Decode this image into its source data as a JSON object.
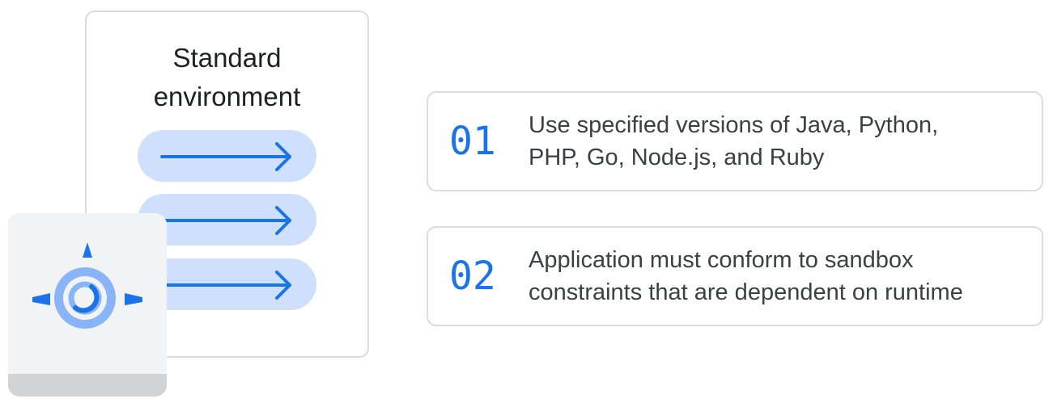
{
  "environment": {
    "title_line1": "Standard",
    "title_line2": "environment",
    "flows": [
      {
        "icon": "arrow-right-icon"
      },
      {
        "icon": "arrow-right-icon"
      },
      {
        "icon": "arrow-right-icon"
      }
    ]
  },
  "app_engine": {
    "icon": "app-engine-icon"
  },
  "items": [
    {
      "number": "01",
      "line1": "Use specified versions of Java, Python,",
      "line2": "PHP, Go, Node.js, and Ruby"
    },
    {
      "number": "02",
      "line1": "Application must conform to sandbox",
      "line2": "constraints that are dependent on runtime"
    }
  ],
  "colors": {
    "accent_blue": "#1a73e8",
    "pill_fill": "#cfe0fc",
    "engine_light_blue": "#8ab4f8",
    "border_gray": "#dadce0"
  }
}
